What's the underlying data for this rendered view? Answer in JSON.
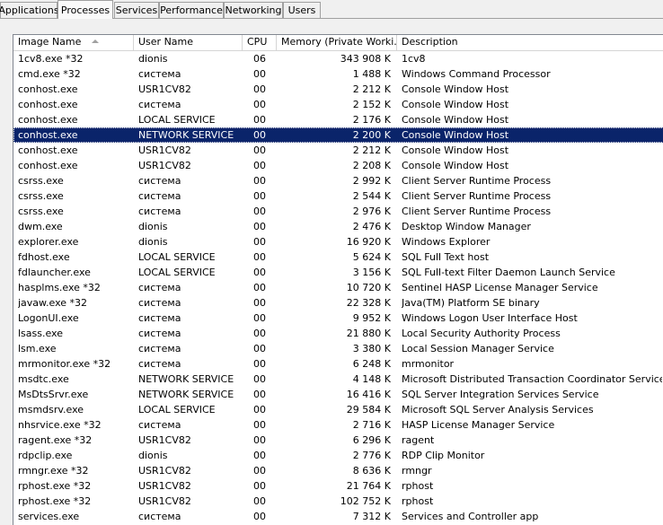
{
  "tabs": [
    {
      "label": "Applications",
      "active": false
    },
    {
      "label": "Processes",
      "active": true
    },
    {
      "label": "Services",
      "active": false
    },
    {
      "label": "Performance",
      "active": false
    },
    {
      "label": "Networking",
      "active": false
    },
    {
      "label": "Users",
      "active": false
    }
  ],
  "columns": {
    "image_name": "Image Name",
    "user_name": "User Name",
    "cpu": "CPU",
    "memory": "Memory (Private Worki...",
    "description": "Description"
  },
  "sort": {
    "column": "image_name",
    "direction": "ascending"
  },
  "selected_index": 5,
  "colors": {
    "selection_bg": "#0a246a",
    "selection_fg": "#ffffff"
  },
  "processes": [
    {
      "name": "1cv8.exe *32",
      "user": "dionis",
      "cpu": "06",
      "mem": "343 908 K",
      "desc": "1cv8"
    },
    {
      "name": "cmd.exe *32",
      "user": "система",
      "cpu": "00",
      "mem": "1 488 K",
      "desc": "Windows Command Processor"
    },
    {
      "name": "conhost.exe",
      "user": "USR1CV82",
      "cpu": "00",
      "mem": "2 212 K",
      "desc": "Console Window Host"
    },
    {
      "name": "conhost.exe",
      "user": "система",
      "cpu": "00",
      "mem": "2 152 K",
      "desc": "Console Window Host"
    },
    {
      "name": "conhost.exe",
      "user": "LOCAL SERVICE",
      "cpu": "00",
      "mem": "2 176 K",
      "desc": "Console Window Host"
    },
    {
      "name": "conhost.exe",
      "user": "NETWORK SERVICE",
      "cpu": "00",
      "mem": "2 200 K",
      "desc": "Console Window Host"
    },
    {
      "name": "conhost.exe",
      "user": "USR1CV82",
      "cpu": "00",
      "mem": "2 212 K",
      "desc": "Console Window Host"
    },
    {
      "name": "conhost.exe",
      "user": "USR1CV82",
      "cpu": "00",
      "mem": "2 208 K",
      "desc": "Console Window Host"
    },
    {
      "name": "csrss.exe",
      "user": "система",
      "cpu": "00",
      "mem": "2 992 K",
      "desc": "Client Server Runtime Process"
    },
    {
      "name": "csrss.exe",
      "user": "система",
      "cpu": "00",
      "mem": "2 544 K",
      "desc": "Client Server Runtime Process"
    },
    {
      "name": "csrss.exe",
      "user": "система",
      "cpu": "00",
      "mem": "2 976 K",
      "desc": "Client Server Runtime Process"
    },
    {
      "name": "dwm.exe",
      "user": "dionis",
      "cpu": "00",
      "mem": "2 476 K",
      "desc": "Desktop Window Manager"
    },
    {
      "name": "explorer.exe",
      "user": "dionis",
      "cpu": "00",
      "mem": "16 920 K",
      "desc": "Windows Explorer"
    },
    {
      "name": "fdhost.exe",
      "user": "LOCAL SERVICE",
      "cpu": "00",
      "mem": "5 624 K",
      "desc": "SQL Full Text host"
    },
    {
      "name": "fdlauncher.exe",
      "user": "LOCAL SERVICE",
      "cpu": "00",
      "mem": "3 156 K",
      "desc": "SQL Full-text Filter Daemon Launch Service"
    },
    {
      "name": "hasplms.exe *32",
      "user": "система",
      "cpu": "00",
      "mem": "10 720 K",
      "desc": "Sentinel HASP License Manager Service"
    },
    {
      "name": "javaw.exe *32",
      "user": "система",
      "cpu": "00",
      "mem": "22 328 K",
      "desc": "Java(TM) Platform SE binary"
    },
    {
      "name": "LogonUI.exe",
      "user": "система",
      "cpu": "00",
      "mem": "9 952 K",
      "desc": "Windows Logon User Interface Host"
    },
    {
      "name": "lsass.exe",
      "user": "система",
      "cpu": "00",
      "mem": "21 880 K",
      "desc": "Local Security Authority Process"
    },
    {
      "name": "lsm.exe",
      "user": "система",
      "cpu": "00",
      "mem": "3 380 K",
      "desc": "Local Session Manager Service"
    },
    {
      "name": "mrmonitor.exe *32",
      "user": "система",
      "cpu": "00",
      "mem": "6 248 K",
      "desc": "mrmonitor"
    },
    {
      "name": "msdtc.exe",
      "user": "NETWORK SERVICE",
      "cpu": "00",
      "mem": "4 148 K",
      "desc": "Microsoft Distributed Transaction Coordinator Service"
    },
    {
      "name": "MsDtsSrvr.exe",
      "user": "NETWORK SERVICE",
      "cpu": "00",
      "mem": "16 416 K",
      "desc": "SQL Server Integration Services Service"
    },
    {
      "name": "msmdsrv.exe",
      "user": "LOCAL SERVICE",
      "cpu": "00",
      "mem": "29 584 K",
      "desc": "Microsoft SQL Server Analysis Services"
    },
    {
      "name": "nhsrvice.exe *32",
      "user": "система",
      "cpu": "00",
      "mem": "2 716 K",
      "desc": "HASP License Manager Service"
    },
    {
      "name": "ragent.exe *32",
      "user": "USR1CV82",
      "cpu": "00",
      "mem": "6 296 K",
      "desc": "ragent"
    },
    {
      "name": "rdpclip.exe",
      "user": "dionis",
      "cpu": "00",
      "mem": "2 776 K",
      "desc": "RDP Clip Monitor"
    },
    {
      "name": "rmngr.exe *32",
      "user": "USR1CV82",
      "cpu": "00",
      "mem": "8 636 K",
      "desc": "rmngr"
    },
    {
      "name": "rphost.exe *32",
      "user": "USR1CV82",
      "cpu": "00",
      "mem": "21 764 K",
      "desc": "rphost"
    },
    {
      "name": "rphost.exe *32",
      "user": "USR1CV82",
      "cpu": "00",
      "mem": "102 752 K",
      "desc": "rphost"
    },
    {
      "name": "services.exe",
      "user": "система",
      "cpu": "00",
      "mem": "7 312 K",
      "desc": "Services and Controller app"
    }
  ]
}
